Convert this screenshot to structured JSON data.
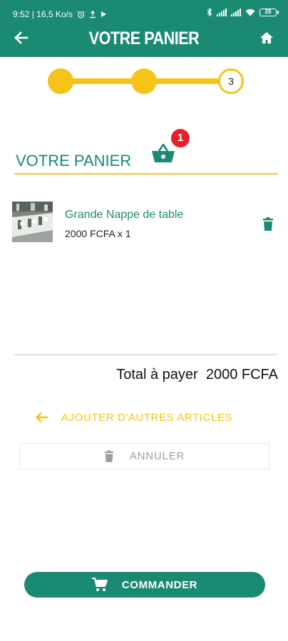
{
  "status_bar": {
    "time_speed": "9:52 | 16,5 Ko/s",
    "battery_level": "28"
  },
  "app_bar": {
    "title": "VOTRE PANIER",
    "back_icon": "arrow-left-icon",
    "home_icon": "home-icon"
  },
  "stepper": {
    "current_step_label": "3",
    "steps_completed": 2,
    "total_steps": 3
  },
  "cart": {
    "heading": "VOTRE PANIER",
    "basket_icon": "basket-icon",
    "badge_count": "1",
    "items": [
      {
        "name": "Grande Nappe de table",
        "price_qty": "2000 FCFA x 1"
      }
    ],
    "total_label": "Total à payer  2000 FCFA"
  },
  "actions": {
    "add_more_label": "AJOUTER D'AUTRES ARTICLES",
    "cancel_label": "ANNULER",
    "order_label": "COMMANDER"
  },
  "colors": {
    "primary": "#1b8a73",
    "accent": "#f6c318",
    "badge": "#e8202a",
    "muted": "#9e9e9e"
  }
}
